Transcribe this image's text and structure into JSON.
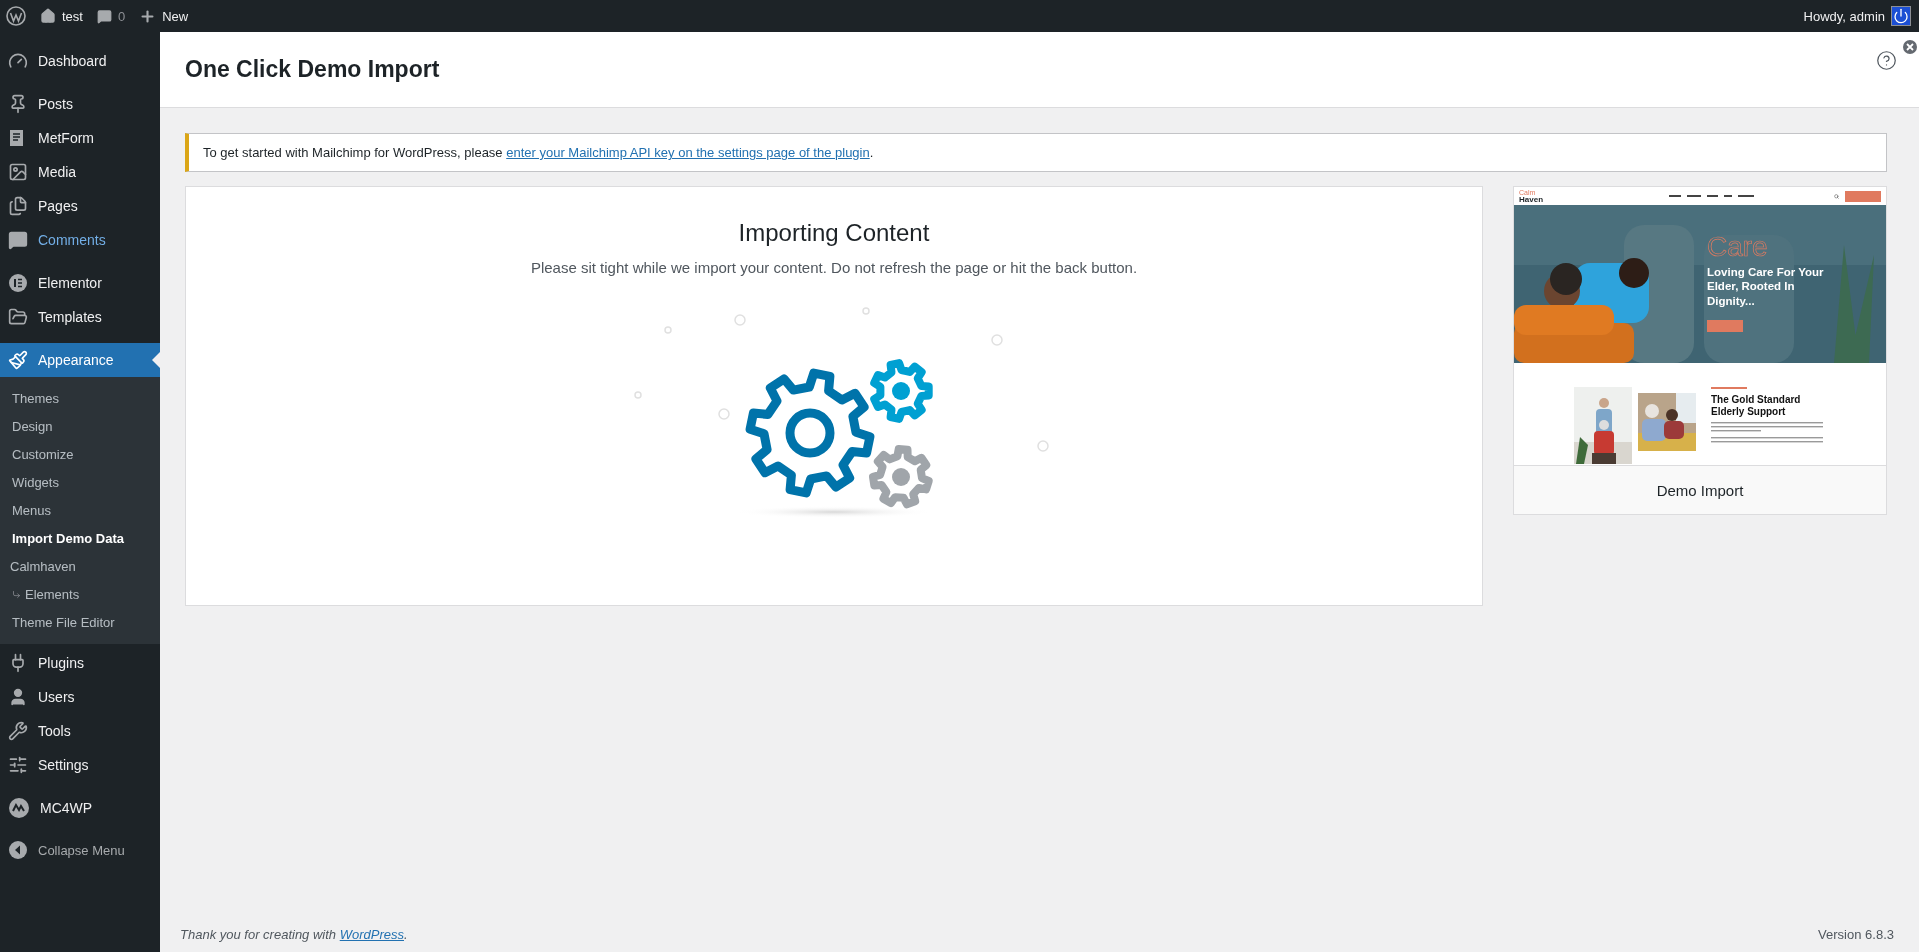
{
  "admin_bar": {
    "site": "test",
    "comments_count": "0",
    "new": "New",
    "greeting": "Howdy, admin"
  },
  "sidebar": {
    "groups": [
      [
        {
          "label": "Dashboard",
          "selected": false,
          "hovered": false
        }
      ],
      [
        {
          "label": "Posts",
          "selected": false,
          "hovered": false
        },
        {
          "label": "MetForm",
          "selected": false,
          "hovered": false
        },
        {
          "label": "Media",
          "selected": false,
          "hovered": false
        },
        {
          "label": "Pages",
          "selected": false,
          "hovered": false
        },
        {
          "label": "Comments",
          "selected": false,
          "hovered": true
        }
      ],
      [
        {
          "label": "Elementor",
          "selected": false,
          "hovered": false
        },
        {
          "label": "Templates",
          "selected": false,
          "hovered": false
        }
      ],
      [
        {
          "label": "Appearance",
          "selected": true,
          "hovered": false,
          "children": [
            {
              "label": "Themes",
              "selected": false
            },
            {
              "label": "Design",
              "selected": false
            },
            {
              "label": "Customize",
              "selected": false
            },
            {
              "label": "Widgets",
              "selected": false
            },
            {
              "label": "Menus",
              "selected": false
            },
            {
              "label": "Import Demo Data",
              "selected": true
            },
            {
              "label": "Calmhaven",
              "selected": false,
              "children": [
                {
                  "label": "Elements",
                  "selected": false
                }
              ]
            },
            {
              "label": "Theme File Editor",
              "selected": false
            }
          ]
        },
        {
          "label": "Plugins",
          "selected": false,
          "hovered": false
        },
        {
          "label": "Users",
          "selected": false,
          "hovered": false
        },
        {
          "label": "Tools",
          "selected": false,
          "hovered": false
        },
        {
          "label": "Settings",
          "selected": false,
          "hovered": false
        }
      ],
      [
        {
          "label": "MC4WP",
          "selected": false,
          "hovered": false
        }
      ]
    ],
    "collapse": "Collapse Menu"
  },
  "header": {
    "title": "One Click Demo Import"
  },
  "notice": {
    "text": "To get started with Mailchimp for WordPress, please ",
    "link": "enter your Mailchimp API key on the settings page of the plugin",
    "after": "."
  },
  "import": {
    "title": "Importing Content",
    "subtitle": "Please sit tight while we import your content. Do not refresh the page or hit the back button."
  },
  "preview": {
    "logo_top": "Calm",
    "logo_bottom": "Haven",
    "hero_word": "Care",
    "hero_title": "Loving Care For Your Elder, Rooted In Dignity...",
    "section_title": "The Gold Standard Elderly Support",
    "caption": "Demo Import"
  },
  "footer": {
    "text": "Thank you for creating with ",
    "link": "WordPress",
    "after": ".",
    "version": "Version 6.8.3"
  }
}
